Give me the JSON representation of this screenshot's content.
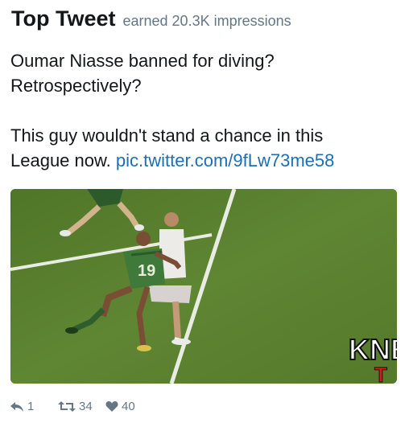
{
  "header": {
    "title": "Top Tweet",
    "earned": "earned 20.3K impressions"
  },
  "tweet": {
    "line1": "Oumar Niasse banned for diving?",
    "line2": "Retrospectively?",
    "line3": "This guy wouldn't stand a chance in this",
    "line4_prefix": "League now. ",
    "link": "pic.twitter.com/9fLw73me58"
  },
  "media": {
    "watermark_top": "KNE",
    "watermark_bottom": "T",
    "jersey_number": "19"
  },
  "actions": {
    "reply_count": "1",
    "retweet_count": "34",
    "like_count": "40"
  },
  "colors": {
    "link": "#1b6fb5",
    "muted": "#657786",
    "pitch": "#5a7c2e",
    "watermark": "#e01818"
  }
}
